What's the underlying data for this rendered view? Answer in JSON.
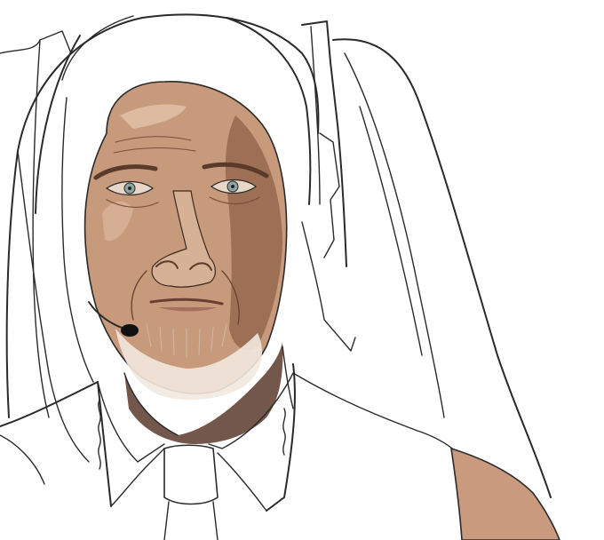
{
  "artwork": {
    "subject": "sketch-portrait",
    "palette": {
      "background": "#ffffff",
      "line": "#2a2a2a",
      "skin_base": "#c89a7c",
      "skin_light": "#e2c3aa",
      "skin_shadow": "#8a5e45",
      "skin_dark": "#5a3a2a",
      "beard": "#f2e8df",
      "eye": "#8fa3a0",
      "lips": "#a66f5f",
      "mic": "#111111",
      "shoulder": "#c99a7e"
    }
  }
}
